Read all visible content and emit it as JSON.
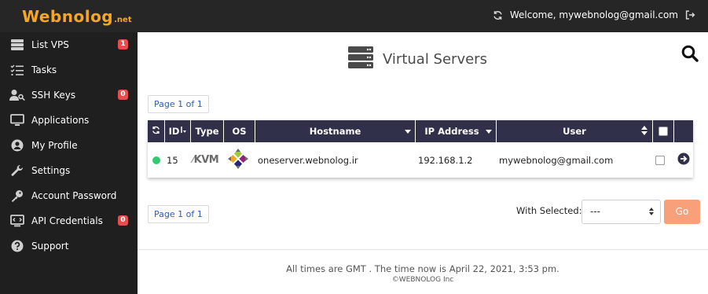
{
  "header": {
    "logo_main": "Webnolog",
    "logo_suffix": ".net",
    "welcome": "Welcome, mywebnolog@gmail.com",
    "icons": [
      "refresh-icon",
      "logout-icon"
    ]
  },
  "sidebar": {
    "items": [
      {
        "label": "List VPS",
        "icon": "server-list-icon",
        "badge": "1"
      },
      {
        "label": "Tasks",
        "icon": "tasks-icon",
        "badge": ""
      },
      {
        "label": "SSH Keys",
        "icon": "user-key-icon",
        "badge": "0"
      },
      {
        "label": "Applications",
        "icon": "monitor-icon",
        "badge": ""
      },
      {
        "label": "My Profile",
        "icon": "user-circle-icon",
        "badge": ""
      },
      {
        "label": "Settings",
        "icon": "wrench-icon",
        "badge": ""
      },
      {
        "label": "Account Password",
        "icon": "key-icon",
        "badge": ""
      },
      {
        "label": "API Credentials",
        "icon": "api-icon",
        "badge": "0"
      },
      {
        "label": "Support",
        "icon": "question-icon",
        "badge": ""
      }
    ]
  },
  "main": {
    "title": "Virtual Servers",
    "pager_top": "Page 1 of 1",
    "pager_bottom": "Page 1 of 1",
    "table": {
      "headers": {
        "id": "ID",
        "type": "Type",
        "os": "OS",
        "hostname": "Hostname",
        "ip": "IP Address",
        "user": "User"
      },
      "rows": [
        {
          "status_color": "#2ecc71",
          "id": "15",
          "type": "KVM",
          "os_icon": "centos-icon",
          "hostname": "oneserver.webnolog.ir",
          "ip": "192.168.1.2",
          "user": "mywebnolog@gmail.com"
        }
      ]
    },
    "with_selected_label": "With Selected:",
    "with_selected_value": "---",
    "go_label": "Go"
  },
  "footer": {
    "time_text": "All times are GMT . The time now is April 22, 2021, 3:53 pm.",
    "copyright": "©WEBNOLOG Inc"
  },
  "colors": {
    "topbar": "#262626",
    "sidebar": "#1f1f1f",
    "table_header": "#30304a",
    "accent_logo": "#f5a623",
    "badge": "#e84c4c",
    "go_button": "#f8a07a",
    "link": "#2a5db0"
  }
}
